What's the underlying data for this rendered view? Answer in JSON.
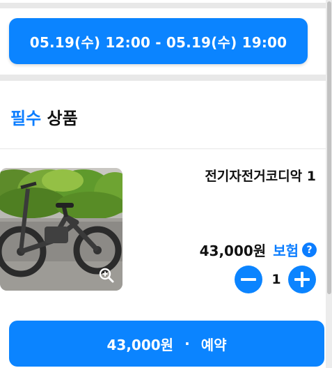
{
  "reservation": {
    "time_range": "05.19(수) 12:00 - 05.19(수) 19:00"
  },
  "section": {
    "title_accent": "필수",
    "title_rest": "상품"
  },
  "product": {
    "name": "전기자전거코디악 1",
    "price": "43,000원",
    "insurance_label": "보험",
    "help_glyph": "?",
    "quantity": "1",
    "image_icon": "zoom-in-icon"
  },
  "footer": {
    "total": "43,000원",
    "separator": "·",
    "action": "예약"
  },
  "colors": {
    "accent": "#0b84ff",
    "link": "#0b7dff",
    "divider": "#e8e8e8"
  }
}
